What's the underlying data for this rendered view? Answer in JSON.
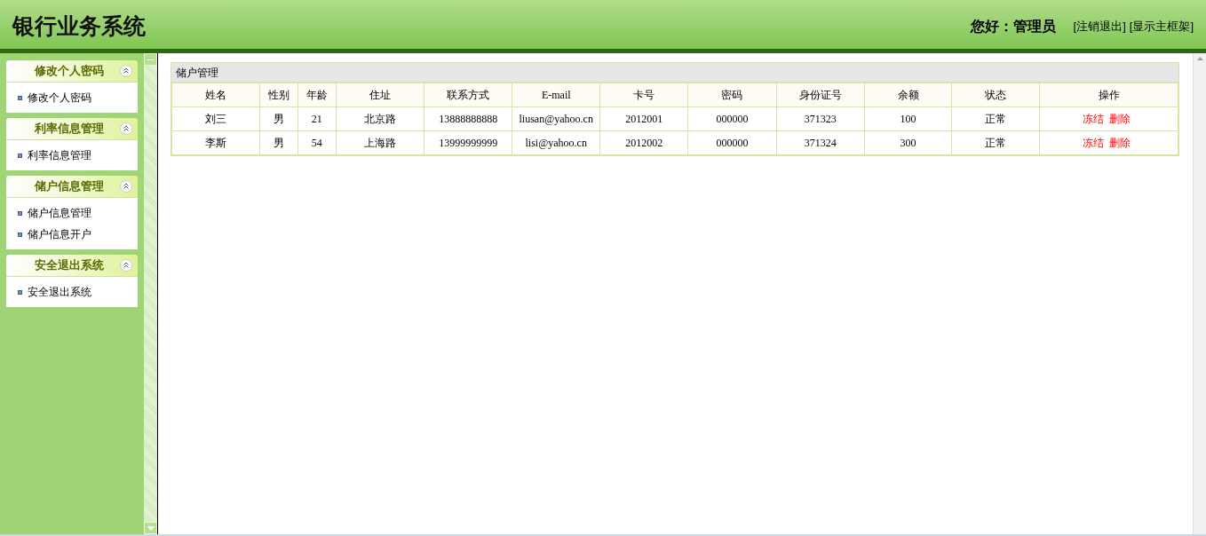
{
  "header": {
    "title": "银行业务系统",
    "greeting": "您好：管理员",
    "links": [
      "[注销退出]",
      "[显示主框架]"
    ]
  },
  "sidebar": {
    "groups": [
      {
        "title": "修改个人密码",
        "expanded": true,
        "items": [
          "修改个人密码"
        ]
      },
      {
        "title": "利率信息管理",
        "expanded": true,
        "items": [
          "利率信息管理"
        ]
      },
      {
        "title": "储户信息管理",
        "expanded": true,
        "items": [
          "储户信息管理",
          "储户信息开户"
        ]
      },
      {
        "title": "安全退出系统",
        "expanded": true,
        "items": [
          "安全退出系统"
        ]
      }
    ]
  },
  "panel": {
    "title": "储户管理",
    "table": {
      "columns": [
        "姓名",
        "性别",
        "年龄",
        "住址",
        "联系方式",
        "E-mail",
        "卡号",
        "密码",
        "身份证号",
        "余额",
        "状态",
        "操作"
      ],
      "rows": [
        {
          "cells": [
            "刘三",
            "男",
            "21",
            "北京路",
            "13888888888",
            "liusan@yahoo.cn",
            "2012001",
            "000000",
            "371323",
            "100",
            "正常"
          ],
          "actions": [
            "冻结",
            "删除"
          ]
        },
        {
          "cells": [
            "李斯",
            "男",
            "54",
            "上海路",
            "13999999999",
            "lisi@yahoo.cn",
            "2012002",
            "000000",
            "371324",
            "300",
            "正常"
          ],
          "actions": [
            "冻结",
            "删除"
          ]
        }
      ]
    }
  }
}
